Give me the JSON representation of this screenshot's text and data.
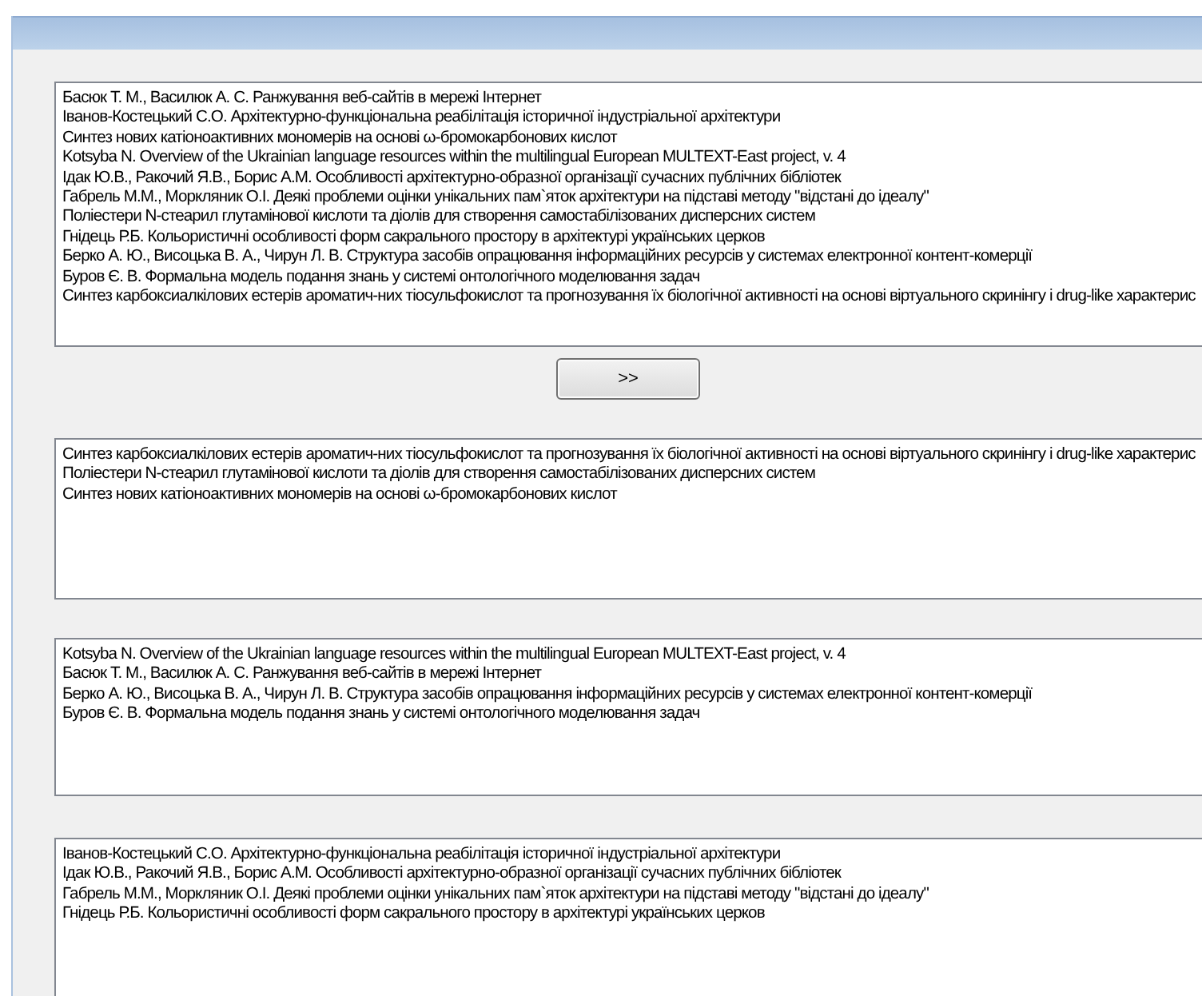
{
  "lists": [
    {
      "items": [
        "Басюк Т. М., Василюк А. С. Ранжування веб-сайтів в мережі Інтернет",
        "Іванов-Костецький С.О. Архітектурно-функціональна реабілітація історичної індустріальної архітектури",
        "Синтез нових катіоноактивних мономерів на основі ω-бромокарбонових кислот",
        "Kotsyba N. Overview of the Ukrainian language resources within the multilingual European MULTEXT-East project, v. 4",
        "Ідак Ю.В., Ракочий Я.В., Борис А.М. Особливості архітектурно-образної організації сучасних публічних бібліотек",
        "Габрель М.М., Моркляник О.І. Деякі проблеми оцінки унікальних пам`яток архітектури на підставі методу \"відстані до ідеалу\"",
        "Поліестери N-стеарил глутамінової кислоти та діолів для створення самостабілізованих дисперсних систем",
        "Гнідець Р.Б. Кольористичні особливості форм сакрального простору в архітектурі українських церков",
        "Берко А. Ю., Висоцька В. А., Чирун Л. В. Структура засобів опрацювання інформаційних ресурсів у системах електронної контент-комерції",
        "Буров Є. В. Формальна модель подання знань у системі онтологічного моделювання задач",
        "Синтез карбоксиалкілових естерів ароматич-них тіосульфокислот та прогнозування їх біологічної активності на основі віртуального скринінгу і drug-like характерис"
      ]
    },
    {
      "button": ">>"
    },
    {
      "items": [
        "Синтез карбоксиалкілових естерів ароматич-них тіосульфокислот та прогнозування їх біологічної активності на основі віртуального скринінгу і drug-like характерис",
        "Поліестери N-стеарил глутамінової кислоти та діолів для створення самостабілізованих дисперсних систем",
        "Синтез нових катіоноактивних мономерів на основі ω-бромокарбонових кислот"
      ]
    },
    {
      "items": [
        "Kotsyba N. Overview of the Ukrainian language resources within the multilingual European MULTEXT-East project, v. 4",
        "Басюк Т. М., Василюк А. С. Ранжування веб-сайтів в мережі Інтернет",
        "Берко А. Ю., Висоцька В. А., Чирун Л. В. Структура засобів опрацювання інформаційних ресурсів у системах електронної контент-комерції",
        "Буров Є. В. Формальна модель подання знань у системі онтологічного моделювання задач"
      ]
    },
    {
      "items": [
        "Іванов-Костецький С.О. Архітектурно-функціональна реабілітація історичної індустріальної архітектури",
        "Ідак Ю.В., Ракочий Я.В., Борис А.М. Особливості архітектурно-образної організації сучасних публічних бібліотек",
        "Габрель М.М., Моркляник О.І. Деякі проблеми оцінки унікальних пам`яток архітектури на підставі методу \"відстані до ідеалу\"",
        "Гнідець Р.Б. Кольористичні особливості форм сакрального простору в архітектурі українських церков"
      ]
    }
  ]
}
